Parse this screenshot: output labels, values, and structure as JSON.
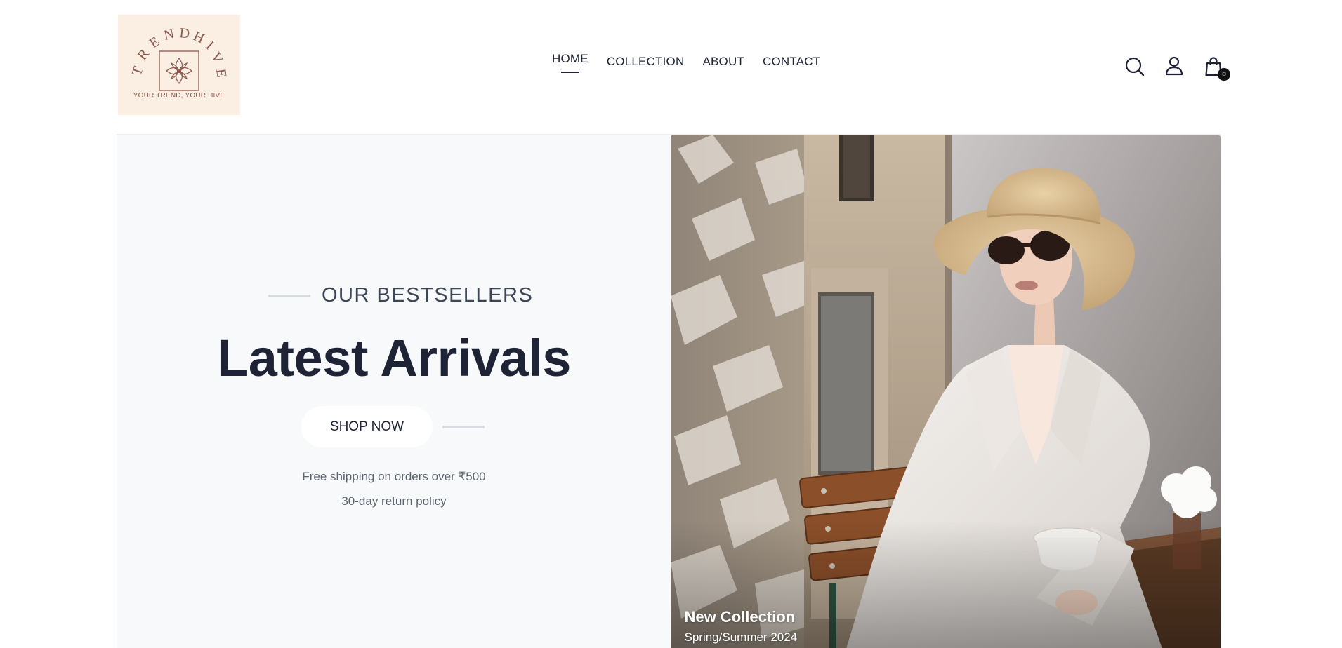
{
  "brand": {
    "name": "TRENDHIVE",
    "tagline": "YOUR TREND, YOUR HIVE",
    "logo_bg": "#fbefe3",
    "logo_color": "#8c5a4e"
  },
  "nav": {
    "items": [
      {
        "label": "HOME",
        "active": true
      },
      {
        "label": "COLLECTION",
        "active": false
      },
      {
        "label": "ABOUT",
        "active": false
      },
      {
        "label": "CONTACT",
        "active": false
      }
    ]
  },
  "header_icons": {
    "search": "search-icon",
    "account": "user-icon",
    "cart": "shopping-bag-icon",
    "cart_count": "0"
  },
  "hero": {
    "eyebrow": "OUR BESTSELLERS",
    "title": "Latest Arrivals",
    "cta_label": "SHOP NOW",
    "info_lines": [
      "Free shipping on orders over ₹500",
      "30-day return policy"
    ],
    "image": {
      "caption_title": "New Collection",
      "caption_subtitle": "Spring/Summer 2024"
    }
  },
  "colors": {
    "text_dark": "#1e2336",
    "hero_bg": "#f8f9fa",
    "accent_line": "#d7dade"
  }
}
